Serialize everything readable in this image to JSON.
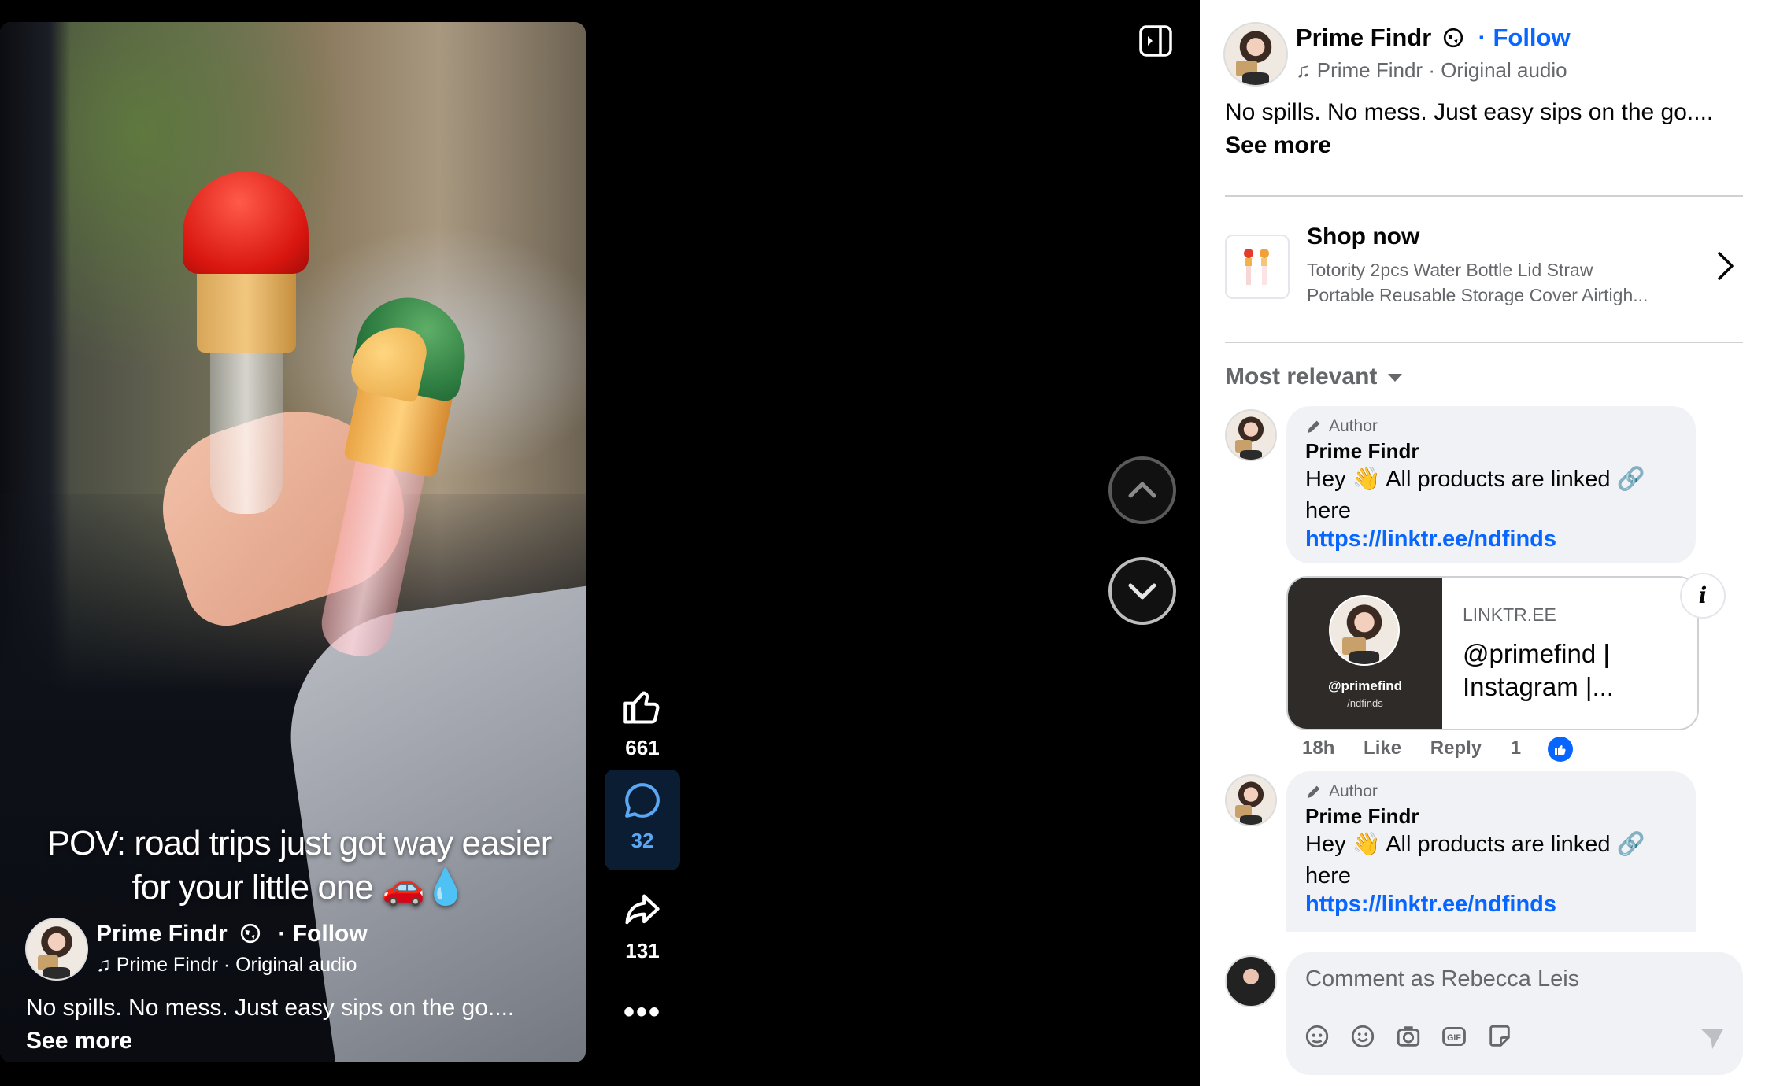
{
  "video": {
    "caption_line1": "POV: road trips just got way easier",
    "caption_line2": "for your little one 🚗💧",
    "author_name": "Prime Findr",
    "follow": "· Follow",
    "audio": "Prime Findr · Original audio",
    "description": "No spills. No mess. Just easy sips on the go....",
    "see_more": "See more"
  },
  "actions": {
    "likes": "661",
    "comments": "32",
    "shares": "131",
    "more": "•••"
  },
  "panel": {
    "author_name": "Prime Findr",
    "follow": "· Follow",
    "audio": "Prime Findr · Original audio",
    "description": "No spills. No mess. Just easy sips on the go....",
    "see_more": "See more",
    "shop": {
      "title": "Shop now",
      "line1": "Totority 2pcs Water Bottle Lid Straw",
      "line2": "Portable Reusable Storage Cover Airtigh..."
    },
    "sort_label": "Most relevant",
    "comments": [
      {
        "badge": "Author",
        "name": "Prime Findr",
        "text1": "Hey 👋 All products are linked 🔗",
        "text2": "here",
        "link": "https://linktr.ee/ndfinds",
        "preview": {
          "handle": "@primefind",
          "sub": "/ndfinds",
          "domain": "LINKTR.EE",
          "title1": "@primefind |",
          "title2": "Instagram |..."
        },
        "time": "18h",
        "like": "Like",
        "reply": "Reply",
        "reactions": "1"
      },
      {
        "badge": "Author",
        "name": "Prime Findr",
        "text1": "Hey 👋 All products are linked 🔗",
        "text2": "here",
        "link": "https://linktr.ee/ndfinds"
      }
    ],
    "composer_placeholder": "Comment as Rebecca Leis"
  },
  "colors": {
    "accent": "#0866ff",
    "active_action": "#5aa8f5"
  }
}
